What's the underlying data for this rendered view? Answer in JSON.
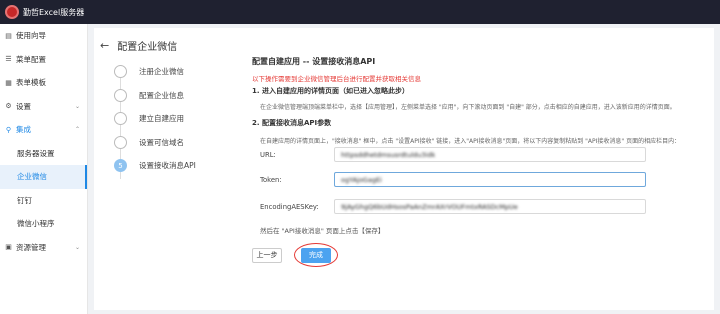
{
  "app": {
    "title": "勤哲Excel服务器",
    "logo_icon": "app-logo-icon"
  },
  "sidebar": {
    "items": [
      {
        "label": "使用向导",
        "icon": "file-icon",
        "glyph": "▤"
      },
      {
        "label": "菜单配置",
        "icon": "list-icon",
        "glyph": "☰"
      },
      {
        "label": "表单模板",
        "icon": "table-icon",
        "glyph": "▦"
      },
      {
        "label": "设置",
        "icon": "gear-icon",
        "glyph": "⚙",
        "chevron": "⌄"
      },
      {
        "label": "集成",
        "icon": "link-icon",
        "glyph": "⚲",
        "chevron": "⌃"
      },
      {
        "label": "服务器设置"
      },
      {
        "label": "企业微信"
      },
      {
        "label": "钉钉"
      },
      {
        "label": "微信小程序"
      },
      {
        "label": "资源管理",
        "icon": "folder-icon",
        "glyph": "▣",
        "chevron": "⌄"
      }
    ]
  },
  "page": {
    "title": "配置企业微信",
    "back_icon": "←"
  },
  "steps": [
    {
      "label": "注册企业微信"
    },
    {
      "label": "配置企业信息"
    },
    {
      "label": "建立自建应用"
    },
    {
      "label": "设置可信域名"
    },
    {
      "number": "5",
      "label": "设置接收消息API"
    }
  ],
  "form": {
    "title": "配置自建应用 -- 设置接收消息API",
    "warning": "以下操作需要到企业微信管理后台进行配置并获取相关信息",
    "section1": "1. 进入自建应用的详情页面（如已进入忽略此步）",
    "section1_note": "在企业微信管理端顶端菜单栏中，选择【应用管理】，左侧菜单选择 \"应用\"，向下滚动页面到 \"自建\" 部分，点击相应的自建应用，进入该新应用的详情页面。",
    "section2": "2. 配置接收消息API参数",
    "section2_note": "在自建应用的详情页面上，\"接收消息\" 框中，点击 \"设置API接收\" 链接，进入\"API接收消息\"页面，将以下内容复制粘贴到 \"API接收消息\" 页面的相应栏目内：",
    "url_label": "URL:",
    "url_value": "httpsddhetdmsusrdtuldu3idk",
    "token_label": "Token:",
    "token_value": "ogYAjoGagEi",
    "aes_label": "EncodingAESKey:",
    "aes_value": "9jAyGhgQ6bUdHsosPaAnZmrAXrVOUFmtxRASDcMpUe",
    "after_note": "然后在 \"API接收消息\" 页面上点击【保存】",
    "prev_button": "上一步",
    "done_button": "完成"
  }
}
